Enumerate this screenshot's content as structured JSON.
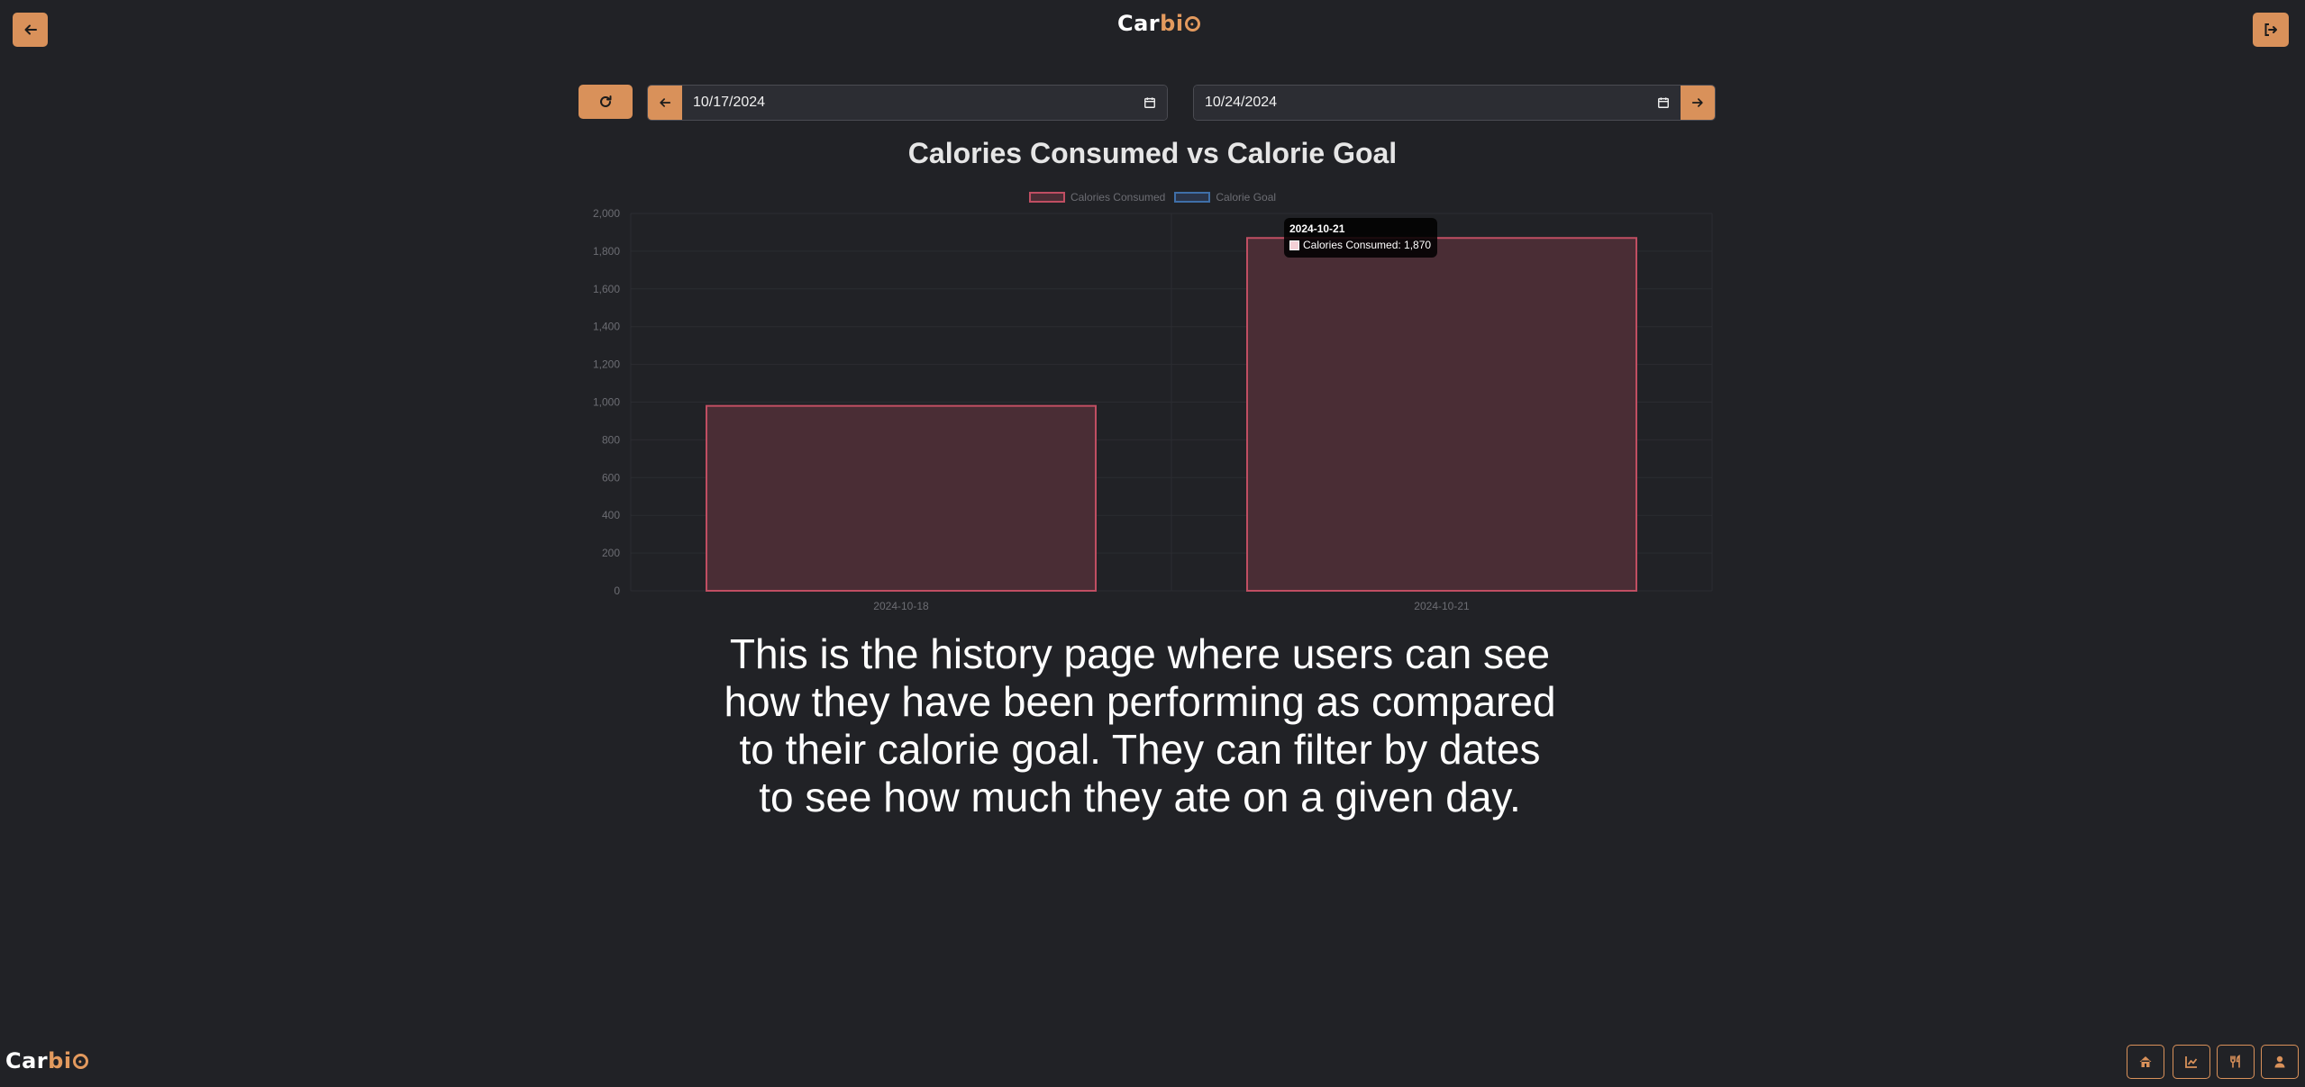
{
  "header": {
    "logo_text_main": "Car",
    "logo_text_accent": "bi",
    "back_icon": "arrow-left-icon",
    "logout_icon": "sign-out-icon"
  },
  "filters": {
    "refresh_icon": "refresh-icon",
    "start_date": "10/17/2024",
    "end_date": "10/24/2024",
    "prev_icon": "arrow-left-icon",
    "next_icon": "arrow-right-icon",
    "calendar_icon": "calendar-icon"
  },
  "chart_data": {
    "type": "bar",
    "title": "Calories Consumed vs Calorie Goal",
    "categories": [
      "2024-10-18",
      "2024-10-21"
    ],
    "series": [
      {
        "name": "Calories Consumed",
        "values": [
          980,
          1870
        ],
        "fill": "#4a2d35",
        "stroke": "#c04e62"
      },
      {
        "name": "Calorie Goal",
        "values": [],
        "fill": "#2a3448",
        "stroke": "#3f6fa8"
      }
    ],
    "ylim": [
      0,
      2000
    ],
    "yticks": [
      0,
      200,
      400,
      600,
      800,
      1000,
      1200,
      1400,
      1600,
      1800,
      2000
    ],
    "ytick_labels": [
      "0",
      "200",
      "400",
      "600",
      "800",
      "1,000",
      "1,200",
      "1,400",
      "1,600",
      "1,800",
      "2,000"
    ],
    "xlabel": "",
    "ylabel": "",
    "legend_position": "top-center",
    "grid": true,
    "tooltip": {
      "title": "2024-10-21",
      "label": "Calories Consumed: 1,870"
    }
  },
  "caption": "This is the history page where users can see how they have been performing as compared to their calorie goal. They can filter by dates to see how much they ate on a given day.",
  "footer": {
    "logo_text_main": "Car",
    "logo_text_accent": "bi",
    "nav_icons": [
      "home-icon",
      "chart-line-icon",
      "utensils-icon",
      "user-icon"
    ]
  },
  "colors": {
    "background": "#212226",
    "accent": "#d9915a",
    "field_bg": "#2c2d33"
  }
}
